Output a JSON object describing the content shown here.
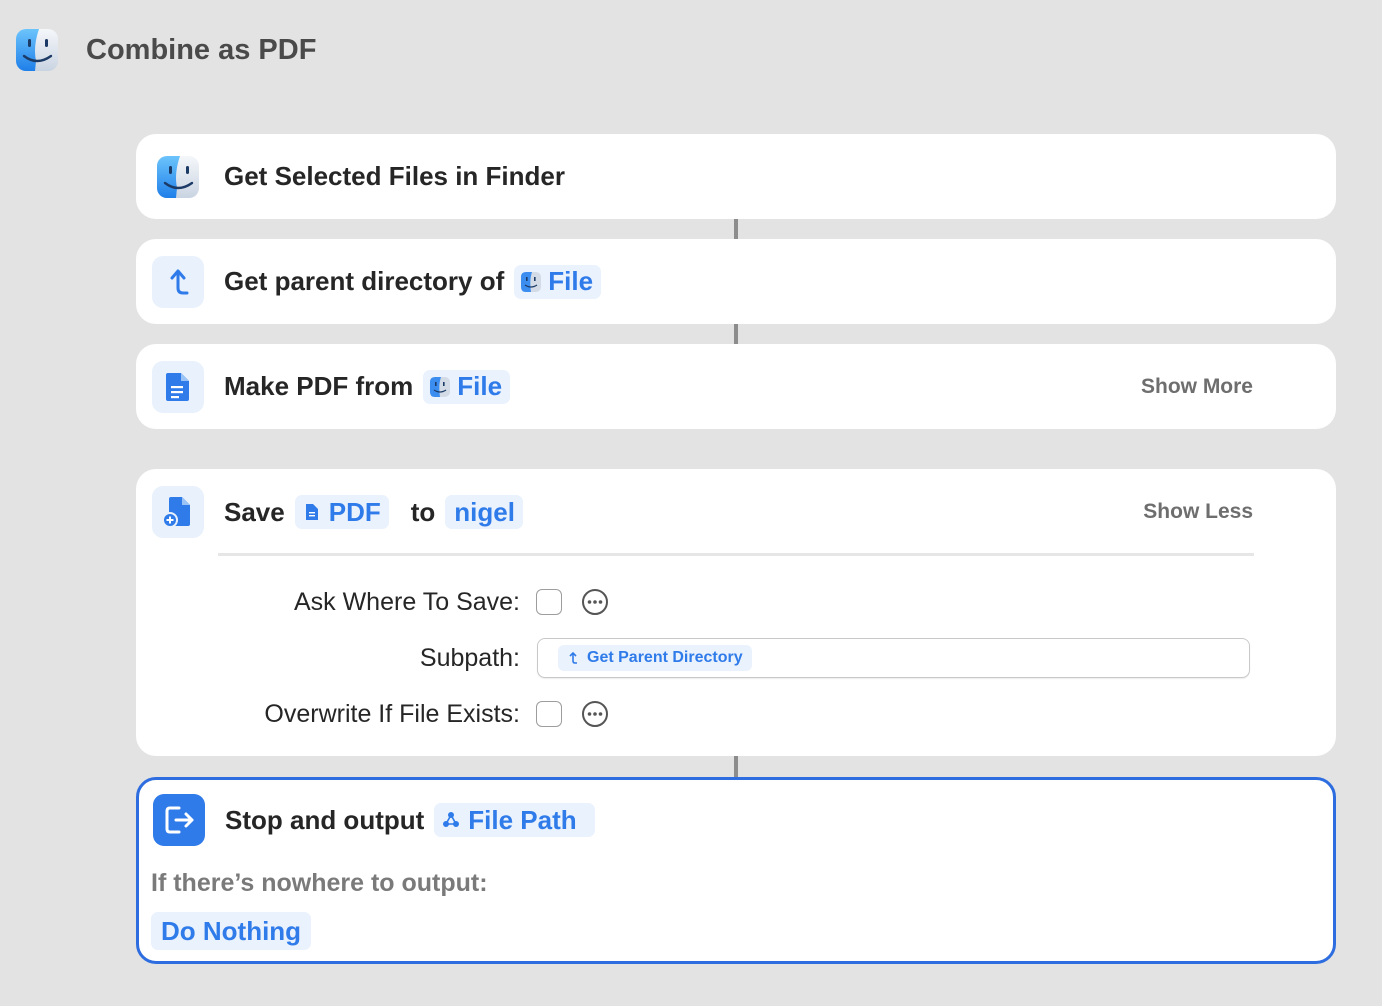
{
  "window": {
    "title": "Combine as PDF",
    "icon": "finder-icon"
  },
  "actions": [
    {
      "label": "Get Selected Files in Finder",
      "icon": "finder-icon"
    },
    {
      "label": "Get parent directory of",
      "icon": "parent-directory-icon",
      "token": "File"
    },
    {
      "label": "Make PDF from",
      "icon": "document-icon",
      "token": "File",
      "toggle": "Show More"
    },
    {
      "label": "Save",
      "icon": "save-file-icon",
      "token": "PDF",
      "connector": "to",
      "destination": "nigel",
      "toggle": "Show Less",
      "params": {
        "ask_where": {
          "label": "Ask Where To Save:",
          "checked": false
        },
        "subpath": {
          "label": "Subpath:",
          "token": "Get Parent Directory"
        },
        "overwrite": {
          "label": "Overwrite If File Exists:",
          "checked": false
        }
      }
    },
    {
      "label": "Stop and output",
      "icon": "exit-icon",
      "token": "File Path",
      "nowhere_label": "If there’s nowhere to output:",
      "nowhere_value": "Do Nothing"
    }
  ],
  "colors": {
    "accent": "#2f7bea",
    "selected_border": "#2d6de0",
    "background": "#e3e3e3",
    "card": "#ffffff"
  }
}
